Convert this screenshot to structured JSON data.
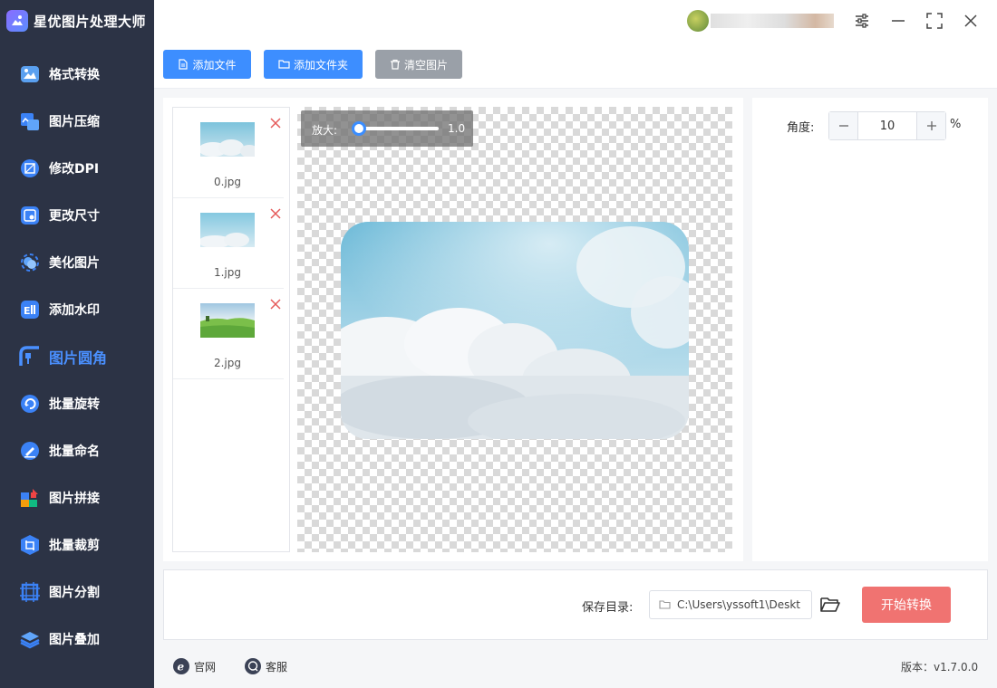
{
  "app": {
    "title": "星优图片处理大师"
  },
  "sidebar": {
    "items": [
      {
        "label": "格式转换",
        "icon": "format-convert-icon"
      },
      {
        "label": "图片压缩",
        "icon": "image-compress-icon"
      },
      {
        "label": "修改DPI",
        "icon": "dpi-icon"
      },
      {
        "label": "更改尺寸",
        "icon": "resize-icon"
      },
      {
        "label": "美化图片",
        "icon": "beautify-icon"
      },
      {
        "label": "添加水印",
        "icon": "watermark-icon"
      },
      {
        "label": "图片圆角",
        "icon": "rounded-corner-icon",
        "active": true
      },
      {
        "label": "批量旋转",
        "icon": "rotate-icon"
      },
      {
        "label": "批量命名",
        "icon": "rename-icon"
      },
      {
        "label": "图片拼接",
        "icon": "stitch-icon"
      },
      {
        "label": "批量裁剪",
        "icon": "crop-icon"
      },
      {
        "label": "图片分割",
        "icon": "split-icon"
      },
      {
        "label": "图片叠加",
        "icon": "overlay-icon"
      }
    ]
  },
  "toolbar": {
    "add_file": "添加文件",
    "add_folder": "添加文件夹",
    "clear_images": "清空图片"
  },
  "files": [
    {
      "name": "0.jpg"
    },
    {
      "name": "1.jpg"
    },
    {
      "name": "2.jpg"
    }
  ],
  "zoom": {
    "label": "放大:",
    "value": "1.0"
  },
  "settings": {
    "angle_label": "角度:",
    "angle_value": "10",
    "unit": "%"
  },
  "output": {
    "save_dir_label": "保存目录:",
    "save_dir_value": "C:\\Users\\yssoft1\\Deskt",
    "start_label": "开始转换"
  },
  "footer": {
    "website": "官网",
    "support": "客服",
    "version": "版本：v1.7.0.0"
  },
  "colors": {
    "sidebar_bg": "#2c3345",
    "accent": "#4a90ff",
    "start_button": "#f07371",
    "delete_icon": "#e55a5a"
  }
}
